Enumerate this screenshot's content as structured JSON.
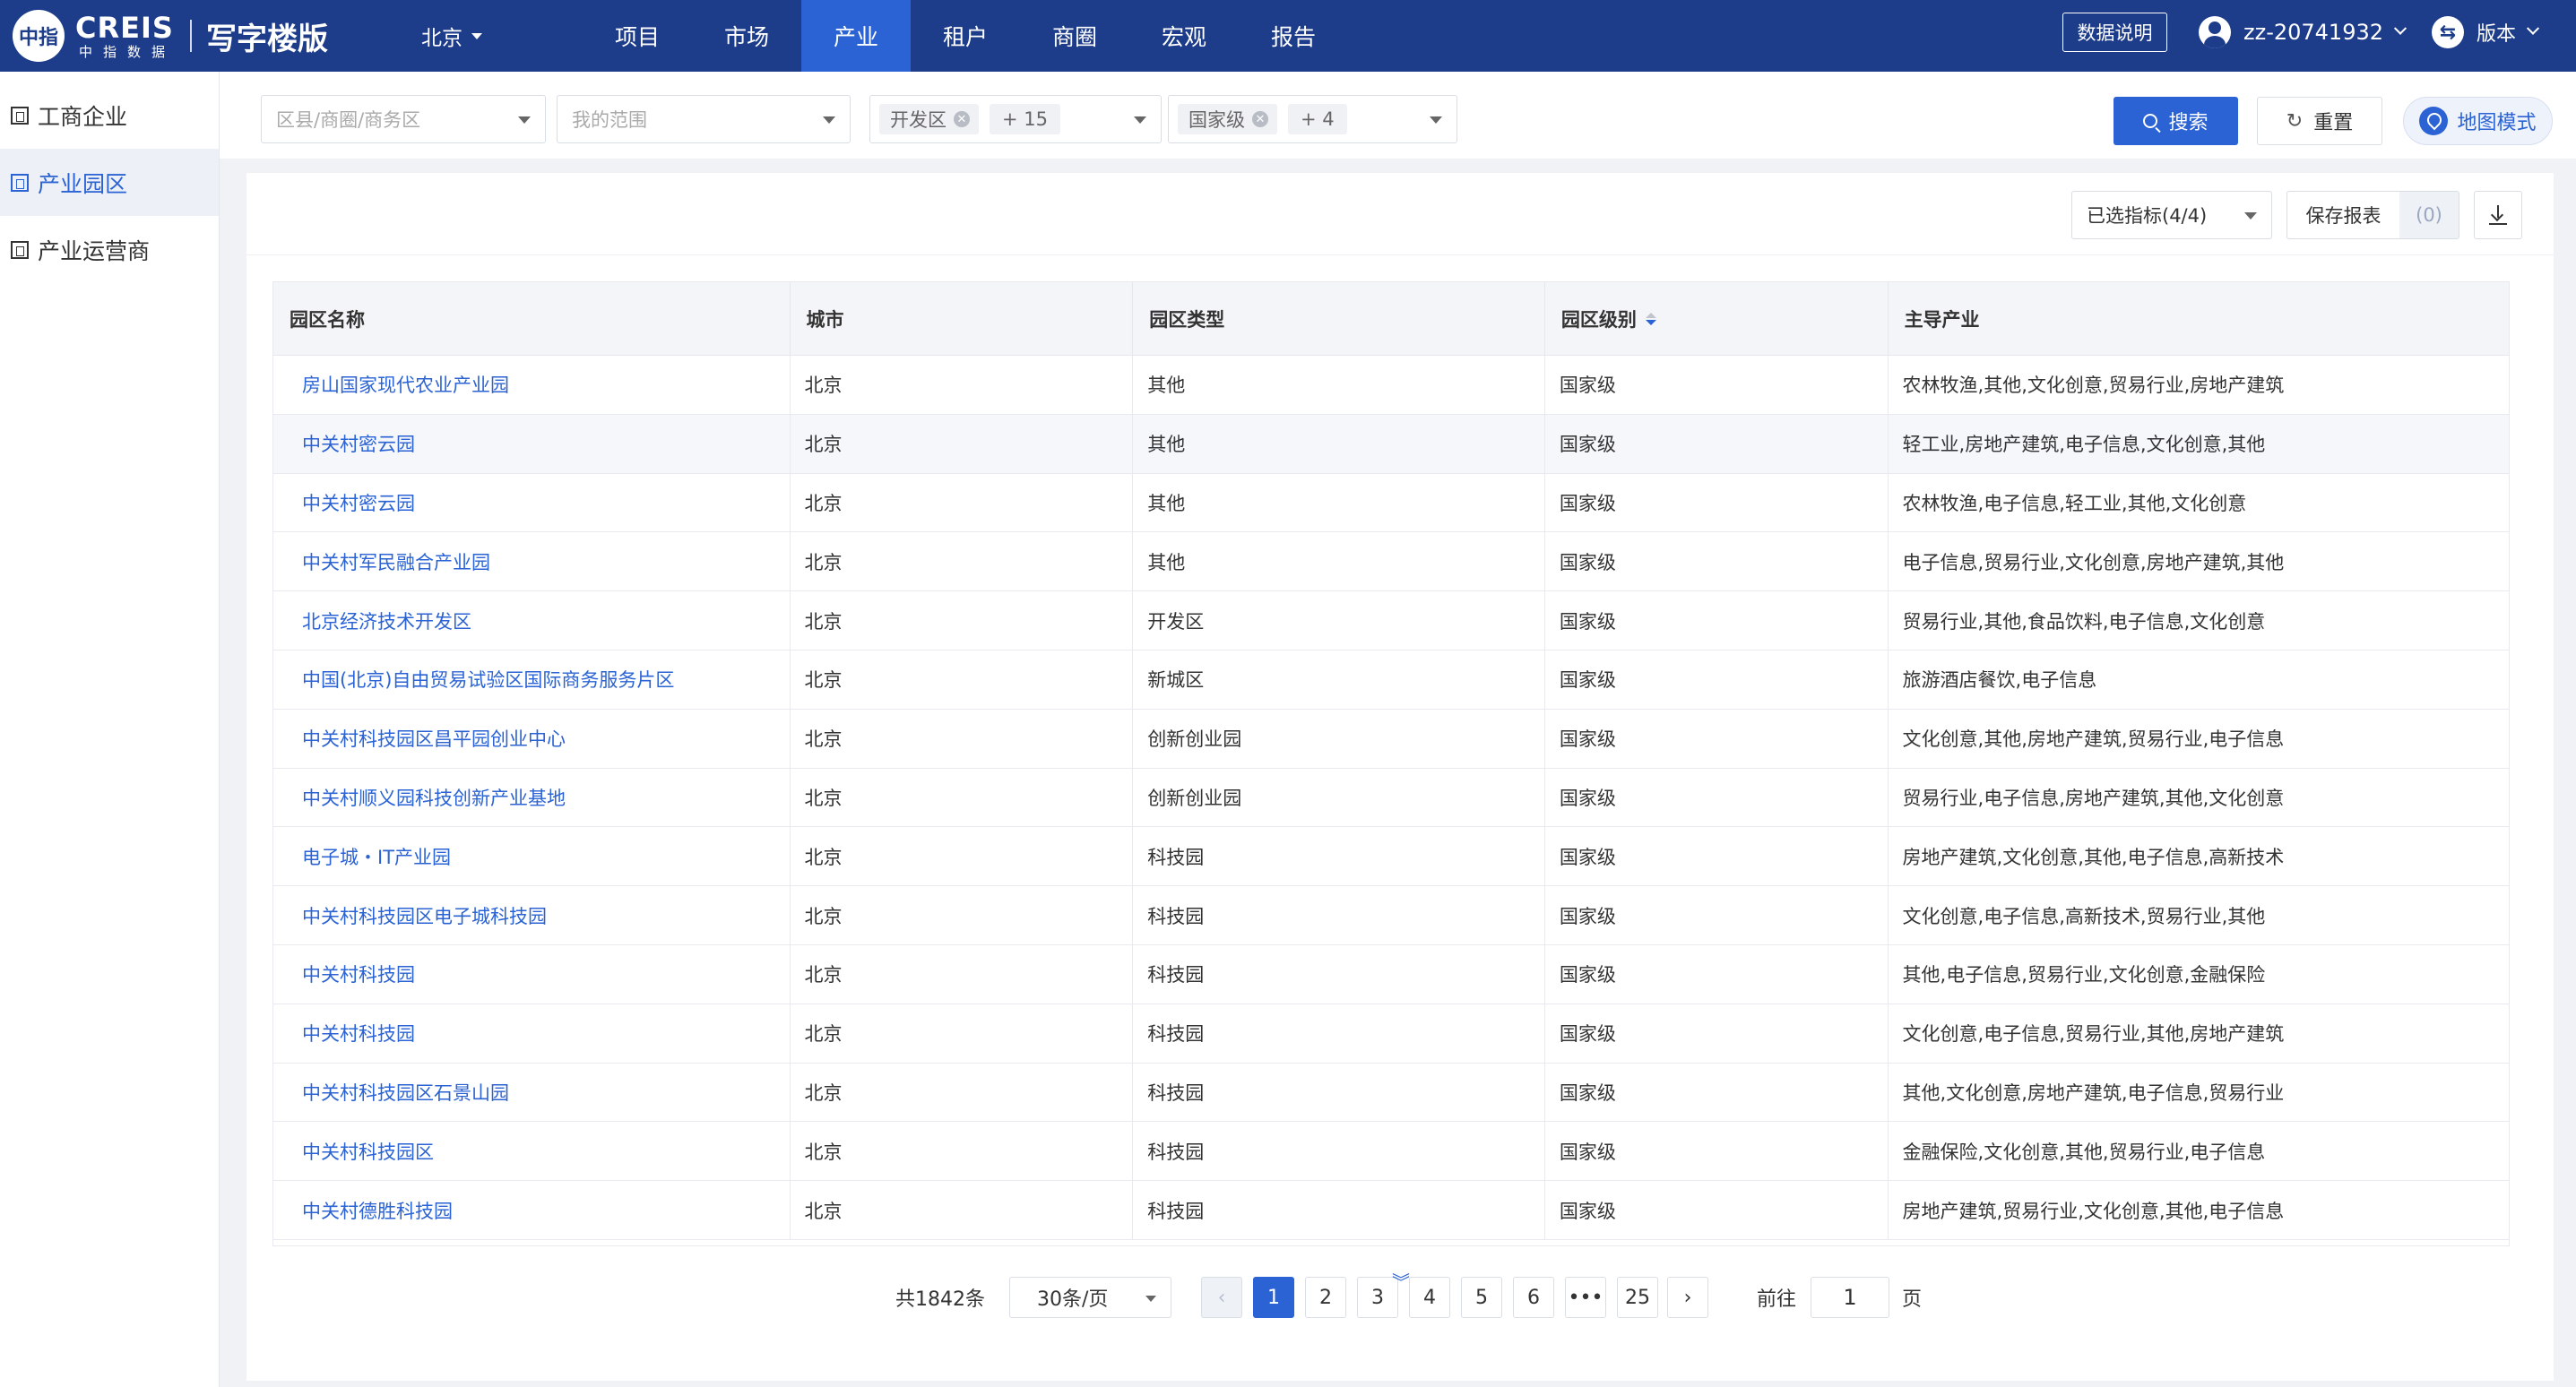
{
  "header": {
    "logo_badge": "中指",
    "logo_main": "CREIS",
    "logo_sub": "中指数据",
    "product": "写字楼版",
    "city": "北京",
    "nav": [
      "项目",
      "市场",
      "产业",
      "租户",
      "商圈",
      "宏观",
      "报告"
    ],
    "active_nav": "产业",
    "data_desc": "数据说明",
    "user": "zz-20741932",
    "version": "版本"
  },
  "sidebar": {
    "items": [
      {
        "label": "工商企业",
        "active": false
      },
      {
        "label": "产业园区",
        "active": true
      },
      {
        "label": "产业运营商",
        "active": false
      }
    ]
  },
  "filters": {
    "district_placeholder": "区县/商圈/商务区",
    "range_placeholder": "我的范围",
    "type_tag": "开发区",
    "type_more": "+ 15",
    "level_tag": "国家级",
    "level_more": "+ 4",
    "search": "搜索",
    "reset": "重置",
    "map_mode": "地图模式"
  },
  "toolbar": {
    "metrics": "已选指标(4/4)",
    "save_report": "保存报表",
    "save_count": "(0)"
  },
  "table": {
    "headers": [
      "园区名称",
      "城市",
      "园区类型",
      "园区级别",
      "主导产业"
    ],
    "rows": [
      [
        "房山国家现代农业产业园",
        "北京",
        "其他",
        "国家级",
        "农林牧渔,其他,文化创意,贸易行业,房地产建筑"
      ],
      [
        "中关村密云园",
        "北京",
        "其他",
        "国家级",
        "轻工业,房地产建筑,电子信息,文化创意,其他"
      ],
      [
        "中关村密云园",
        "北京",
        "其他",
        "国家级",
        "农林牧渔,电子信息,轻工业,其他,文化创意"
      ],
      [
        "中关村军民融合产业园",
        "北京",
        "其他",
        "国家级",
        "电子信息,贸易行业,文化创意,房地产建筑,其他"
      ],
      [
        "北京经济技术开发区",
        "北京",
        "开发区",
        "国家级",
        "贸易行业,其他,食品饮料,电子信息,文化创意"
      ],
      [
        "中国(北京)自由贸易试验区国际商务服务片区",
        "北京",
        "新城区",
        "国家级",
        "旅游酒店餐饮,电子信息"
      ],
      [
        "中关村科技园区昌平园创业中心",
        "北京",
        "创新创业园",
        "国家级",
        "文化创意,其他,房地产建筑,贸易行业,电子信息"
      ],
      [
        "中关村顺义园科技创新产业基地",
        "北京",
        "创新创业园",
        "国家级",
        "贸易行业,电子信息,房地产建筑,其他,文化创意"
      ],
      [
        "电子城・IT产业园",
        "北京",
        "科技园",
        "国家级",
        "房地产建筑,文化创意,其他,电子信息,高新技术"
      ],
      [
        "中关村科技园区电子城科技园",
        "北京",
        "科技园",
        "国家级",
        "文化创意,电子信息,高新技术,贸易行业,其他"
      ],
      [
        "中关村科技园",
        "北京",
        "科技园",
        "国家级",
        "其他,电子信息,贸易行业,文化创意,金融保险"
      ],
      [
        "中关村科技园",
        "北京",
        "科技园",
        "国家级",
        "文化创意,电子信息,贸易行业,其他,房地产建筑"
      ],
      [
        "中关村科技园区石景山园",
        "北京",
        "科技园",
        "国家级",
        "其他,文化创意,房地产建筑,电子信息,贸易行业"
      ],
      [
        "中关村科技园区",
        "北京",
        "科技园",
        "国家级",
        "金融保险,文化创意,其他,贸易行业,电子信息"
      ],
      [
        "中关村德胜科技园",
        "北京",
        "科技园",
        "国家级",
        "房地产建筑,贸易行业,文化创意,其他,电子信息"
      ]
    ]
  },
  "pagination": {
    "total": "共1842条",
    "page_size": "30条/页",
    "pages": [
      "1",
      "2",
      "3",
      "4",
      "5",
      "6",
      "•••",
      "25"
    ],
    "current": "1",
    "goto_label": "前往",
    "goto_value": "1",
    "goto_suffix": "页"
  },
  "colors": {
    "primary": "#2b63d4",
    "header_bg": "#1d3c8a"
  }
}
